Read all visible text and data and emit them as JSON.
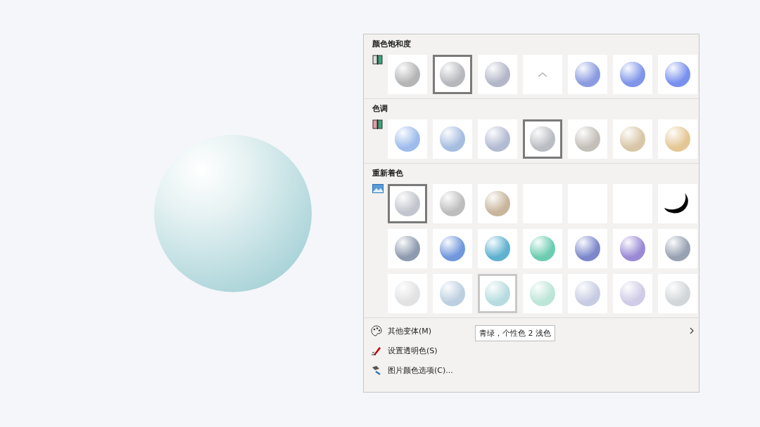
{
  "slide": {
    "color": "#a9d3d8"
  },
  "sections": [
    {
      "title": "颜色饱和度",
      "rows": [
        [
          {
            "kind": "sphere",
            "color": "#b5b5b5",
            "selected": false,
            "hovered": false
          },
          {
            "kind": "sphere",
            "color": "#b7b8bd",
            "selected": true,
            "hovered": false
          },
          {
            "kind": "sphere",
            "color": "#b3b6c8",
            "selected": false,
            "hovered": false
          },
          {
            "kind": "caret",
            "selected": false,
            "hovered": false
          },
          {
            "kind": "sphere",
            "color": "#8a9be0",
            "selected": false,
            "hovered": false
          },
          {
            "kind": "sphere",
            "color": "#7f95ea",
            "selected": false,
            "hovered": false
          },
          {
            "kind": "sphere",
            "color": "#7890ee",
            "selected": false,
            "hovered": false
          }
        ]
      ]
    },
    {
      "title": "色调",
      "rows": [
        [
          {
            "kind": "sphere",
            "color": "#9dbcec",
            "selected": false,
            "hovered": false
          },
          {
            "kind": "sphere",
            "color": "#a6bde0",
            "selected": false,
            "hovered": false
          },
          {
            "kind": "sphere",
            "color": "#b3bbd2",
            "selected": false,
            "hovered": false
          },
          {
            "kind": "sphere",
            "color": "#bbbdc4",
            "selected": true,
            "hovered": false
          },
          {
            "kind": "sphere",
            "color": "#c4bfb8",
            "selected": false,
            "hovered": false
          },
          {
            "kind": "sphere",
            "color": "#d8c6a6",
            "selected": false,
            "hovered": false
          },
          {
            "kind": "sphere",
            "color": "#e4c794",
            "selected": false,
            "hovered": false
          }
        ]
      ]
    },
    {
      "title": "重新着色",
      "rows": [
        [
          {
            "kind": "sphere",
            "color": "#c3c5ce",
            "selected": true,
            "hovered": false
          },
          {
            "kind": "sphere",
            "color": "#bdbdbd",
            "selected": false,
            "hovered": false
          },
          {
            "kind": "sphere",
            "color": "#c8b59c",
            "selected": false,
            "hovered": false
          },
          {
            "kind": "blank",
            "selected": false,
            "hovered": false
          },
          {
            "kind": "blank",
            "selected": false,
            "hovered": false
          },
          {
            "kind": "blank",
            "selected": false,
            "hovered": false
          },
          {
            "kind": "crescent",
            "selected": false,
            "hovered": false
          }
        ],
        [
          {
            "kind": "sphere",
            "color": "#8e9bae",
            "selected": false,
            "hovered": false
          },
          {
            "kind": "sphere",
            "color": "#7197dc",
            "selected": false,
            "hovered": false
          },
          {
            "kind": "sphere",
            "color": "#5fb1d0",
            "selected": false,
            "hovered": false
          },
          {
            "kind": "sphere",
            "color": "#6ccdb0",
            "selected": false,
            "hovered": false
          },
          {
            "kind": "sphere",
            "color": "#7d88cc",
            "selected": false,
            "hovered": false
          },
          {
            "kind": "sphere",
            "color": "#9a8ad6",
            "selected": false,
            "hovered": false
          },
          {
            "kind": "sphere",
            "color": "#98a2b2",
            "selected": false,
            "hovered": false
          }
        ],
        [
          {
            "kind": "sphere",
            "color": "#e2e2e2",
            "selected": false,
            "hovered": false
          },
          {
            "kind": "sphere",
            "color": "#bccfe0",
            "selected": false,
            "hovered": false
          },
          {
            "kind": "sphere",
            "color": "#b6dcdf",
            "selected": false,
            "hovered": true
          },
          {
            "kind": "sphere",
            "color": "#bde5d8",
            "selected": false,
            "hovered": false
          },
          {
            "kind": "sphere",
            "color": "#c8cce2",
            "selected": false,
            "hovered": false
          },
          {
            "kind": "sphere",
            "color": "#d0cbe6",
            "selected": false,
            "hovered": false
          },
          {
            "kind": "sphere",
            "color": "#d2d6d9",
            "selected": false,
            "hovered": false
          }
        ]
      ]
    }
  ],
  "tooltip": "青绿，个性色 2 浅色",
  "menu": [
    {
      "label": "其他变体(M)",
      "submenu": true
    },
    {
      "label": "设置透明色(S)",
      "submenu": false
    },
    {
      "label": "图片颜色选项(C)...",
      "submenu": false
    }
  ]
}
